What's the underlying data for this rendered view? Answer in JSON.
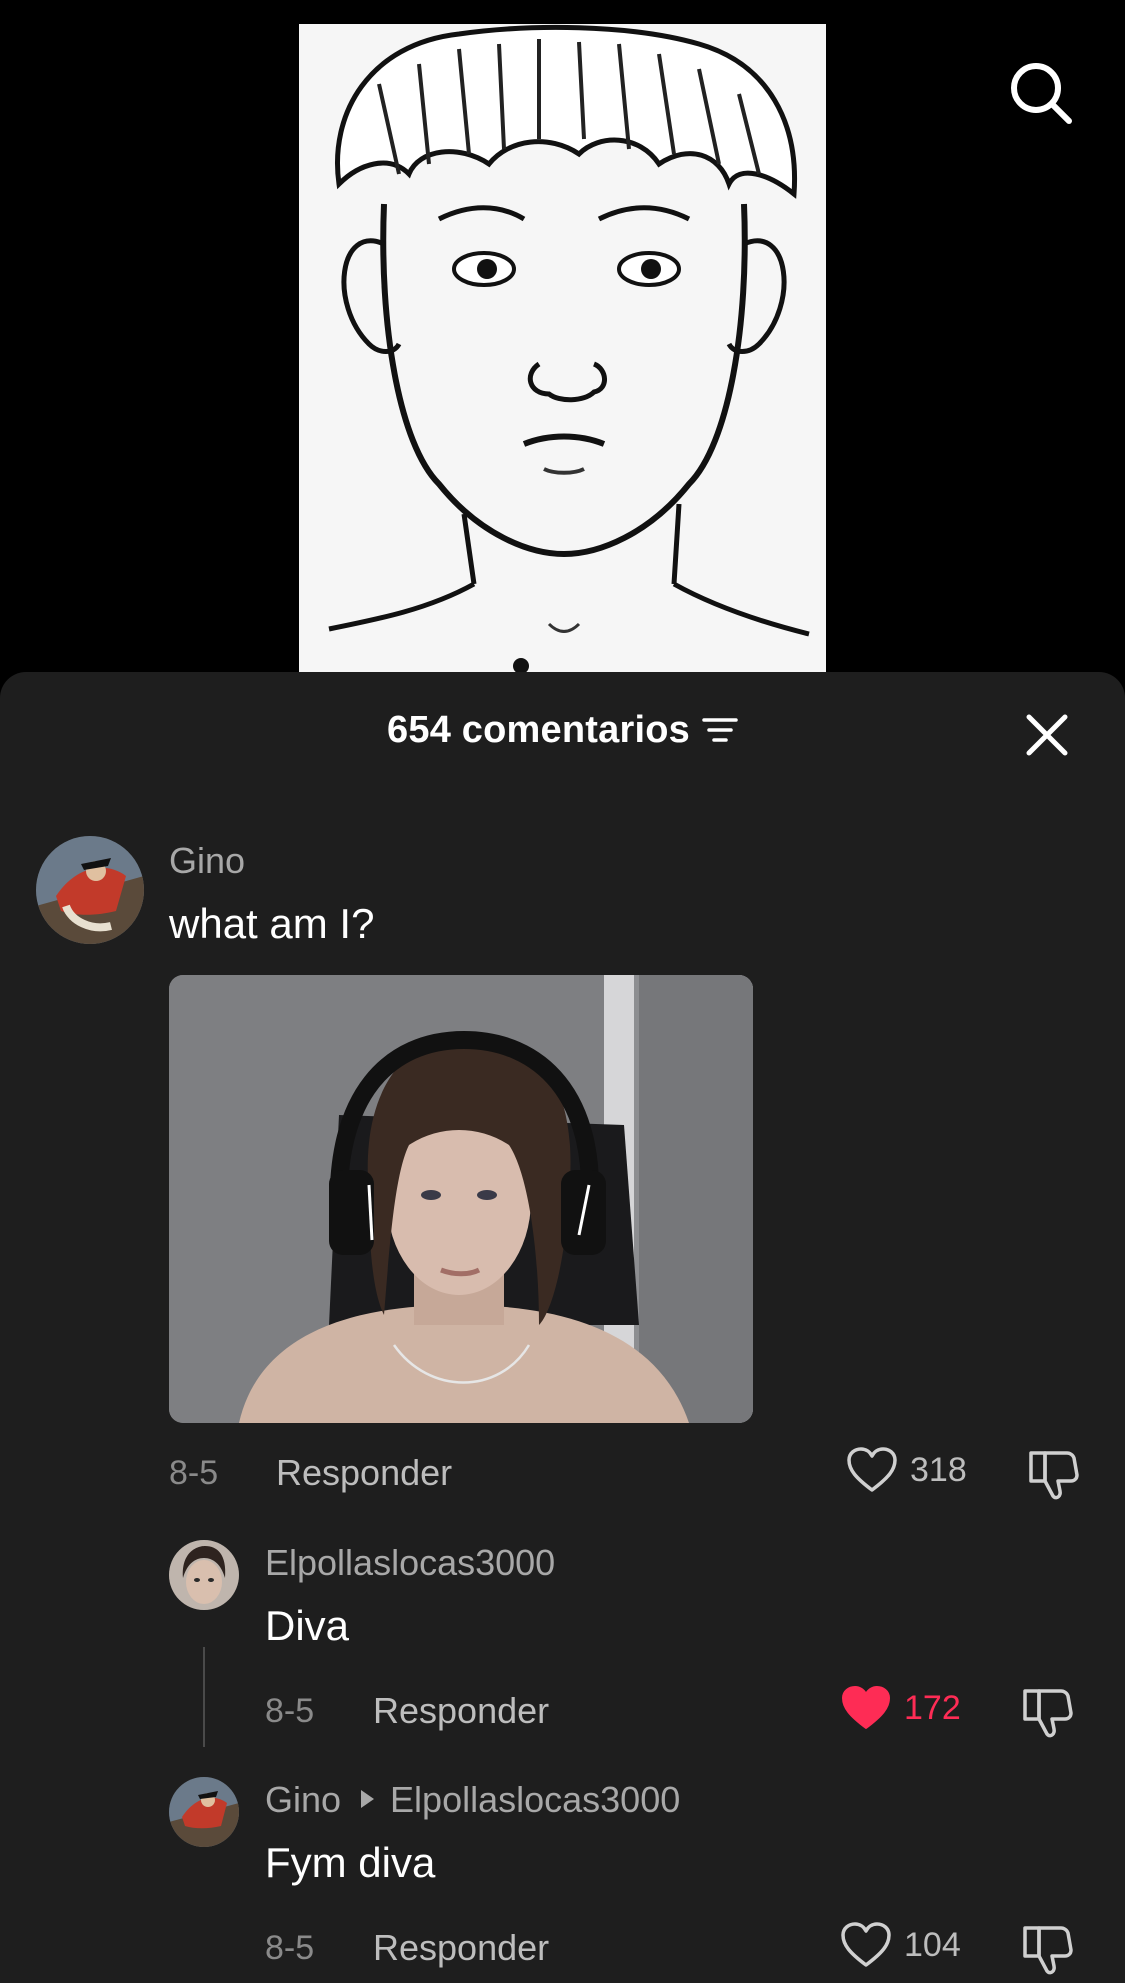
{
  "header": {
    "comment_count": "654 comentarios",
    "filter_icon": "filter-icon",
    "close_icon": "close-icon"
  },
  "top_bar": {
    "search_icon": "search-icon"
  },
  "comments": [
    {
      "username": "Gino",
      "text": "what am I?",
      "has_image": true,
      "date": "8-5",
      "reply_label": "Responder",
      "likes": "318",
      "liked": false
    },
    {
      "username": "Elpollaslocas3000",
      "text": "Diva",
      "date": "8-5",
      "reply_label": "Responder",
      "likes": "172",
      "liked": true
    },
    {
      "username": "Gino",
      "reply_to": "Elpollaslocas3000",
      "text": "Fym diva",
      "date": "8-5",
      "reply_label": "Responder",
      "likes": "104",
      "liked": false
    }
  ],
  "colors": {
    "sheet_bg": "#1e1e1e",
    "liked_red": "#fe2c55",
    "muted_text": "#a8a8a8"
  }
}
